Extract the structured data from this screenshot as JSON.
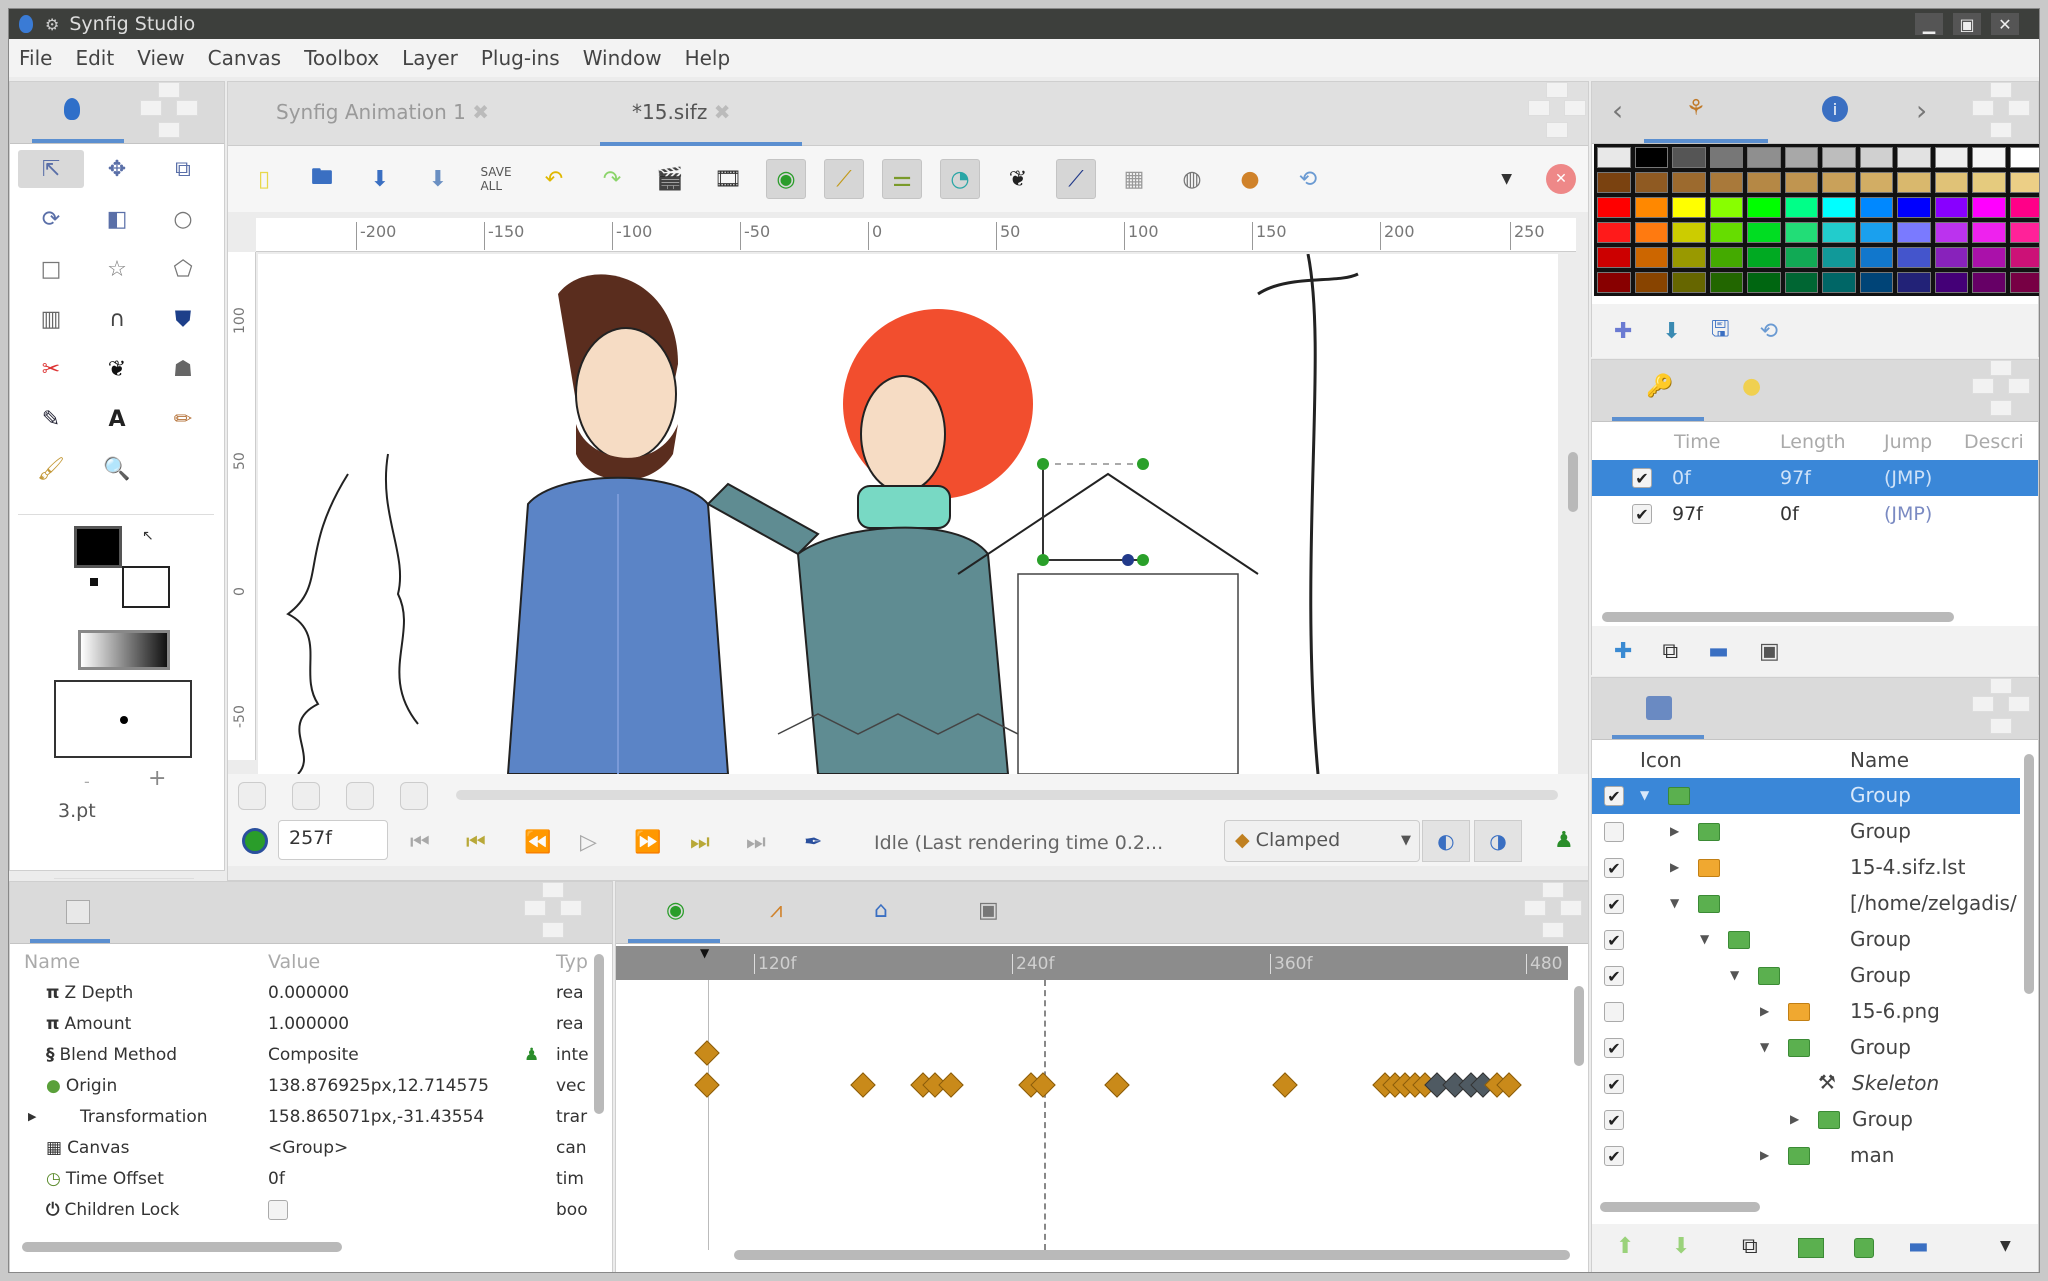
{
  "window": {
    "title": "Synfig Studio",
    "controls": [
      "minimize",
      "maximize",
      "close"
    ]
  },
  "menubar": [
    "File",
    "Edit",
    "View",
    "Canvas",
    "Toolbox",
    "Layer",
    "Plug-ins",
    "Window",
    "Help"
  ],
  "toolbox": {
    "tools": [
      "transform-tool",
      "smooth-move-tool",
      "scale-tool",
      "rotate-tool",
      "mirror-tool",
      "circle-tool",
      "rectangle-tool",
      "star-tool",
      "polygon-tool",
      "gradient-tool",
      "spline-tool",
      "fill-tool",
      "cutout-tool",
      "width-tool",
      "skeleton-tool",
      "eyedropper-tool",
      "text-tool",
      "sketch-tool",
      "brush-tool",
      "zoom-tool"
    ],
    "outline_color": "#000000",
    "fill_color": "#ffffff",
    "brush_size": "3.pt",
    "minus": "-",
    "plus": "+"
  },
  "documents": {
    "tabs": [
      {
        "label": "Synfig Animation 1",
        "active": false
      },
      {
        "label": "*15.sifz",
        "active": true
      }
    ],
    "close_glyph": "✖"
  },
  "ruler": {
    "h_labels": [
      "-200",
      "-150",
      "-100",
      "-50",
      "0",
      "50",
      "100",
      "150",
      "200",
      "250"
    ],
    "v_labels": [
      "100",
      "50",
      "0",
      "-50"
    ]
  },
  "frame_controls": {
    "current_frame": "257f",
    "status": "Idle (Last rendering time 0.2...",
    "interpolation": "Clamped"
  },
  "params": {
    "headers": {
      "name": "Name",
      "value": "Value",
      "type": "Typ"
    },
    "rows": [
      {
        "icon": "π",
        "name": "Z Depth",
        "value": "0.000000",
        "type": "rea"
      },
      {
        "icon": "π",
        "name": "Amount",
        "value": "1.000000",
        "type": "rea"
      },
      {
        "icon": "§",
        "name": "Blend Method",
        "value": "Composite",
        "type": "inte"
      },
      {
        "icon": "●",
        "name": "Origin",
        "value": "138.876925px,12.714575",
        "type": "vec"
      },
      {
        "icon": "",
        "name": "Transformation",
        "value": "158.865071px,-31.43554",
        "type": "trar"
      },
      {
        "icon": "▦",
        "name": "Canvas",
        "value": "<Group>",
        "type": "can"
      },
      {
        "icon": "◷",
        "name": "Time Offset",
        "value": "0f",
        "type": "tim"
      },
      {
        "icon": "⏻",
        "name": "Children Lock",
        "value": "",
        "type": "boo"
      }
    ]
  },
  "timetrack": {
    "labels": [
      "120f",
      "240f",
      "360f",
      "480"
    ]
  },
  "palette": {
    "rows": [
      [
        "#e8e8e8",
        "#000000",
        "#555555",
        "#777777",
        "#8f8f8f",
        "#a8a8a8",
        "#bdbdbd",
        "#d0d0d0",
        "#e2e2e2",
        "#eeeeee",
        "#f6f6f6",
        "#ffffff"
      ],
      [
        "#7a4210",
        "#8f5a22",
        "#9c6a2e",
        "#a9793a",
        "#b58845",
        "#c09550",
        "#c9a15a",
        "#d2ad64",
        "#d9b86d",
        "#e0c277",
        "#e5cb7e",
        "#eccf86"
      ],
      [
        "#ff0000",
        "#ff8800",
        "#ffff00",
        "#88ff00",
        "#00ff00",
        "#00ff88",
        "#00ffff",
        "#0088ff",
        "#0000ff",
        "#8800ff",
        "#ff00ff",
        "#ff0088"
      ],
      [
        "#ff1a1a",
        "#ff7a10",
        "#cccc00",
        "#66dd00",
        "#00dd22",
        "#22dd77",
        "#22cccc",
        "#1aa0ee",
        "#7a7aff",
        "#bb33ee",
        "#ee22ee",
        "#ff2299"
      ],
      [
        "#cc0000",
        "#cc6600",
        "#999900",
        "#44aa00",
        "#00aa22",
        "#11aa55",
        "#119999",
        "#1177cc",
        "#4455cc",
        "#8822bb",
        "#aa11aa",
        "#cc1177"
      ],
      [
        "#880000",
        "#884400",
        "#666600",
        "#226600",
        "#006611",
        "#006633",
        "#006666",
        "#004477",
        "#222277",
        "#440077",
        "#660066",
        "#770044"
      ]
    ]
  },
  "waypoints": {
    "headers": [
      "Time",
      "Length",
      "Jump",
      "Descri"
    ],
    "rows": [
      {
        "checked": true,
        "time": "0f",
        "length": "97f",
        "jump": "(JMP)",
        "selected": true
      },
      {
        "checked": true,
        "time": "97f",
        "length": "0f",
        "jump": "(JMP)",
        "selected": false
      }
    ]
  },
  "layers": {
    "headers": {
      "icon": "Icon",
      "name": "Name"
    },
    "rows": [
      {
        "checked": true,
        "depth": 0,
        "expander": "open",
        "kind": "group",
        "name": "Group",
        "selected": true
      },
      {
        "checked": false,
        "depth": 1,
        "expander": "closed",
        "kind": "group",
        "name": "Group"
      },
      {
        "checked": true,
        "depth": 1,
        "expander": "closed",
        "kind": "import",
        "name": "15-4.sifz.lst"
      },
      {
        "checked": true,
        "depth": 1,
        "expander": "open",
        "kind": "group",
        "name": "[/home/zelgadis/"
      },
      {
        "checked": true,
        "depth": 2,
        "expander": "open",
        "kind": "group",
        "name": "Group"
      },
      {
        "checked": true,
        "depth": 3,
        "expander": "open",
        "kind": "group",
        "name": "Group"
      },
      {
        "checked": false,
        "depth": 4,
        "expander": "closed",
        "kind": "import",
        "name": "15-6.png"
      },
      {
        "checked": true,
        "depth": 4,
        "expander": "open",
        "kind": "group",
        "name": "Group"
      },
      {
        "checked": true,
        "depth": 5,
        "expander": "none",
        "kind": "skeleton",
        "name": "Skeleton"
      },
      {
        "checked": true,
        "depth": 5,
        "expander": "closed",
        "kind": "group",
        "name": "Group"
      },
      {
        "checked": true,
        "depth": 4,
        "expander": "closed",
        "kind": "group",
        "name": "man"
      }
    ]
  }
}
